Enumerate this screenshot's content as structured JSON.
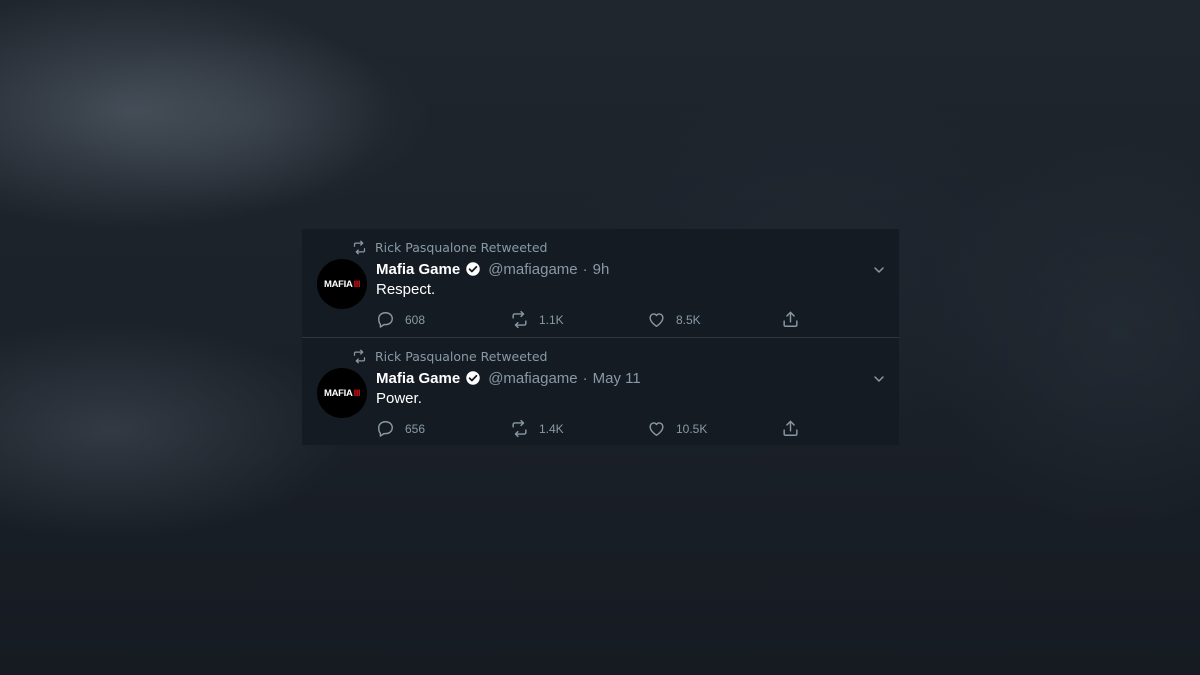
{
  "colors": {
    "background": "#1a1f26",
    "panel": "#151b23",
    "muted_text": "#8899a6",
    "primary_text": "#ffffff",
    "logo_accent": "#d0121b"
  },
  "tweets": [
    {
      "retweeted_by": "Rick Pasqualone Retweeted",
      "avatar_logo": "MAFIA",
      "avatar_logo_suffix": "III",
      "author_name": "Mafia Game",
      "handle": "@mafiagame",
      "separator": "·",
      "time": "9h",
      "text": "Respect.",
      "replies": "608",
      "retweets": "1.1K",
      "likes": "8.5K",
      "icons": [
        "retweet-icon",
        "verified-badge-icon",
        "chevron-down-icon",
        "reply-icon",
        "retweet-icon",
        "like-icon",
        "share-icon"
      ]
    },
    {
      "retweeted_by": "Rick Pasqualone Retweeted",
      "avatar_logo": "MAFIA",
      "avatar_logo_suffix": "III",
      "author_name": "Mafia Game",
      "handle": "@mafiagame",
      "separator": "·",
      "time": "May 11",
      "text": "Power.",
      "replies": "656",
      "retweets": "1.4K",
      "likes": "10.5K",
      "icons": [
        "retweet-icon",
        "verified-badge-icon",
        "chevron-down-icon",
        "reply-icon",
        "retweet-icon",
        "like-icon",
        "share-icon"
      ]
    }
  ]
}
